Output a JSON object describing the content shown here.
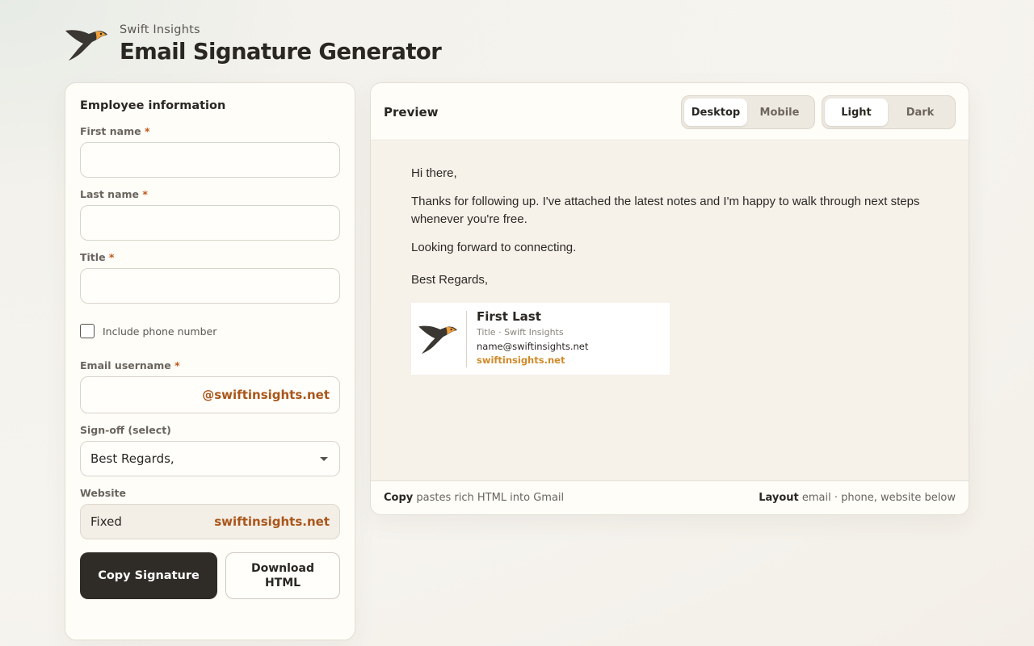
{
  "header": {
    "brand_name": "Swift Insights",
    "page_title": "Email Signature Generator",
    "logo_icon": "swift-bird-logo"
  },
  "form": {
    "heading": "Employee information",
    "required_mark": "*",
    "first_name": {
      "label": "First name",
      "value": ""
    },
    "last_name": {
      "label": "Last name",
      "value": ""
    },
    "title": {
      "label": "Title",
      "value": ""
    },
    "include_phone": {
      "label": "Include phone number",
      "checked": false
    },
    "email_username": {
      "label": "Email username",
      "value": "",
      "suffix": "@swiftinsights.net"
    },
    "signoff": {
      "label": "Sign-off (select)",
      "value": "Best Regards,"
    },
    "website": {
      "label": "Website",
      "left": "Fixed",
      "value": "swiftinsights.net"
    },
    "copy_button": "Copy Signature",
    "download_button": "Download HTML"
  },
  "preview": {
    "title": "Preview",
    "device_tabs": [
      "Desktop",
      "Mobile"
    ],
    "device_selected": "Desktop",
    "theme_tabs": [
      "Light",
      "Dark"
    ],
    "theme_selected": "Light",
    "email": {
      "greeting": "Hi there,",
      "body": "Thanks for following up. I've attached the latest notes and I'm happy to walk through next steps whenever you're free.",
      "closing_line": "Looking forward to connecting.",
      "signoff": "Best Regards,"
    },
    "signature": {
      "name": "First Last",
      "title_line": "Title · Swift Insights",
      "email": "name@swiftinsights.net",
      "website": "swiftinsights.net"
    },
    "footer": {
      "left_strong": "Copy",
      "left_text": "pastes rich HTML into Gmail",
      "right_strong": "Layout",
      "right_text": "email · phone, website below"
    }
  },
  "colors": {
    "accent": "#a9561b",
    "primary_button": "#2f2b27",
    "logo_orange": "#f0a03c",
    "logo_dark": "#3a3631"
  }
}
